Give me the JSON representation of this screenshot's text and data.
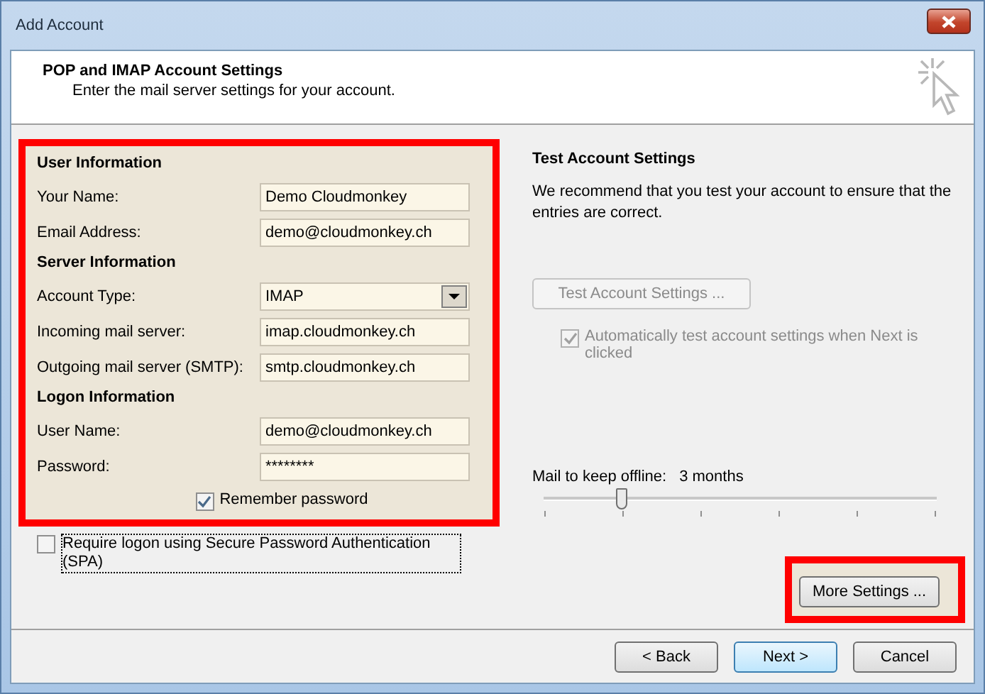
{
  "window": {
    "title": "Add Account"
  },
  "header": {
    "title": "POP and IMAP Account Settings",
    "subtitle": "Enter the mail server settings for your account."
  },
  "account_panel": {
    "highlighted": true,
    "sections": [
      {
        "heading": "User Information",
        "fields": [
          {
            "label": "Your Name:",
            "kind": "text",
            "value": "Demo Cloudmonkey"
          },
          {
            "label": "Email Address:",
            "kind": "text",
            "value": "demo@cloudmonkey.ch"
          }
        ]
      },
      {
        "heading": "Server Information",
        "fields": [
          {
            "label": "Account Type:",
            "kind": "select",
            "value": "IMAP"
          },
          {
            "label": "Incoming mail server:",
            "kind": "text",
            "value": "imap.cloudmonkey.ch"
          },
          {
            "label": "Outgoing mail server (SMTP):",
            "kind": "text",
            "value": "smtp.cloudmonkey.ch"
          }
        ]
      },
      {
        "heading": "Logon Information",
        "fields": [
          {
            "label": "User Name:",
            "kind": "text",
            "value": "demo@cloudmonkey.ch"
          },
          {
            "label": "Password:",
            "kind": "password",
            "value": "********"
          }
        ]
      }
    ],
    "remember_password": {
      "label": "Remember password",
      "checked": true
    }
  },
  "spa": {
    "label": "Require logon using Secure Password Authentication (SPA)",
    "checked": false
  },
  "test_settings": {
    "heading": "Test Account Settings",
    "description": "We recommend that you test your account to ensure that the entries are correct.",
    "button": {
      "label": "Test Account Settings ...",
      "disabled": true
    },
    "auto_test": {
      "label": "Automatically test account settings when Next is clicked",
      "checked": true,
      "disabled": true
    }
  },
  "offline": {
    "label": "Mail to keep offline:",
    "value": "3 months",
    "level": 0.2
  },
  "more_settings": {
    "label": "More Settings ...",
    "highlighted": true
  },
  "buttons": [
    {
      "label": "< Back",
      "default": false
    },
    {
      "label": "Next >",
      "default": true
    },
    {
      "label": "Cancel",
      "default": false
    }
  ]
}
